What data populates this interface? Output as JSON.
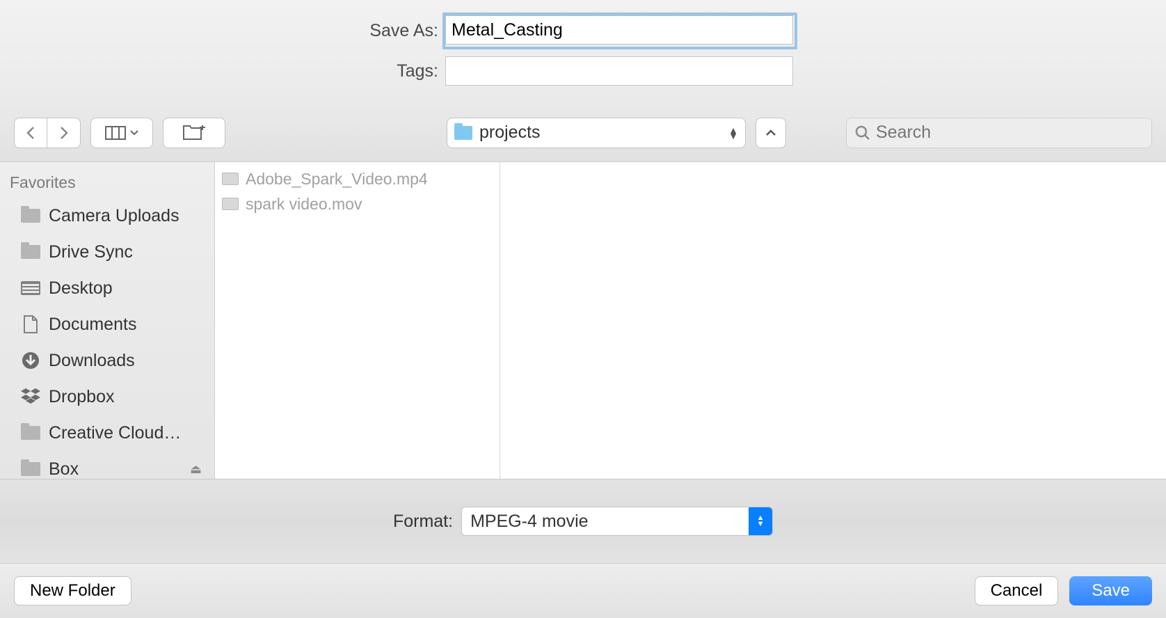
{
  "header": {
    "save_as_label": "Save As:",
    "save_as_value": "Metal_Casting",
    "tags_label": "Tags:",
    "tags_value": ""
  },
  "toolbar": {
    "folder_name": "projects",
    "search_placeholder": "Search"
  },
  "sidebar": {
    "section_label": "Favorites",
    "items": [
      {
        "label": "Camera Uploads",
        "icon": "folder"
      },
      {
        "label": "Drive Sync",
        "icon": "folder"
      },
      {
        "label": "Desktop",
        "icon": "desktop"
      },
      {
        "label": "Documents",
        "icon": "document"
      },
      {
        "label": "Downloads",
        "icon": "downloads"
      },
      {
        "label": "Dropbox",
        "icon": "dropbox"
      },
      {
        "label": "Creative Cloud…",
        "icon": "folder"
      },
      {
        "label": "Box",
        "icon": "folder",
        "ejectable": true
      }
    ]
  },
  "files": [
    {
      "name": "Adobe_Spark_Video.mp4"
    },
    {
      "name": "spark video.mov"
    }
  ],
  "format": {
    "label": "Format:",
    "value": "MPEG-4 movie"
  },
  "buttons": {
    "new_folder": "New Folder",
    "cancel": "Cancel",
    "save": "Save"
  }
}
